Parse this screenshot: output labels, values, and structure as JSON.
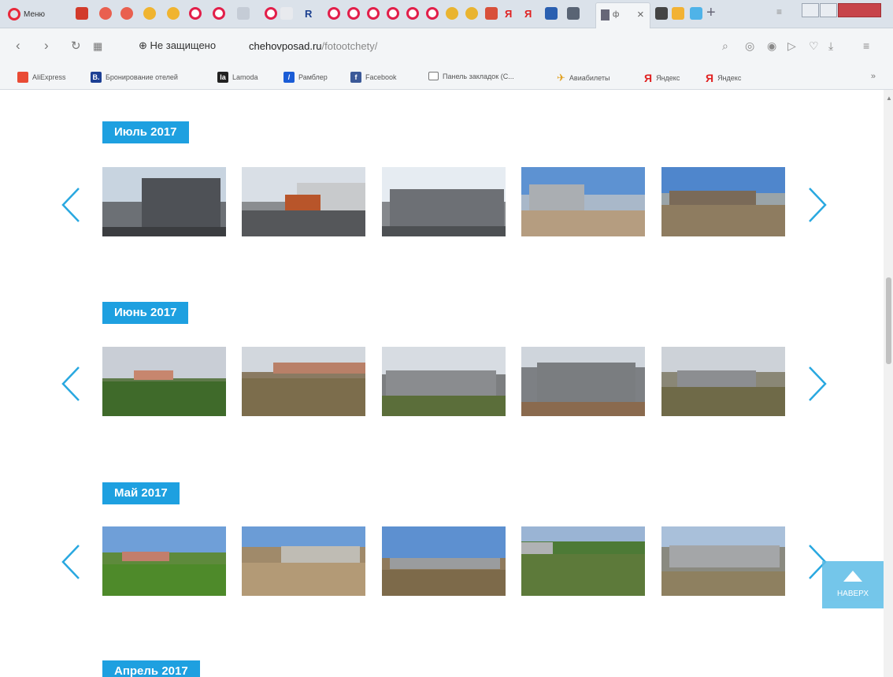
{
  "browser": {
    "menu_label": "Меню",
    "active_tab_label": "ф",
    "security_text": "Не защищено",
    "url_host": "chehovposad.ru",
    "url_path": "/fotootchety/",
    "bookmarks": [
      {
        "label": "AliExpress",
        "color": "#e94b35",
        "glyph": ""
      },
      {
        "label": "Бронирование отелей",
        "color": "#1c3f94",
        "glyph": "B."
      },
      {
        "label": "Lamoda",
        "color": "#222222",
        "glyph": "la"
      },
      {
        "label": "Рамблер",
        "color": "#1a5cd6",
        "glyph": "/"
      },
      {
        "label": "Facebook",
        "color": "#3b5998",
        "glyph": "f"
      },
      {
        "label": "Панель закладок (С...",
        "color": "#ffffff",
        "glyph": ""
      },
      {
        "label": "Авиабилеты",
        "color": "#ffffff",
        "glyph": ""
      },
      {
        "label": "Яндекс",
        "color": "#ffffff",
        "glyph": "Я"
      },
      {
        "label": "Яндекс",
        "color": "#ffffff",
        "glyph": "Я"
      }
    ],
    "bookmarks_more": "»"
  },
  "sections": [
    {
      "month": "Июль 2017"
    },
    {
      "month": "Июнь 2017"
    },
    {
      "month": "Май 2017"
    },
    {
      "month": "Апрель 2017"
    }
  ],
  "back_to_top": "НАВЕРХ",
  "colors": {
    "accent": "#1ea0e0",
    "arrow": "#29a8e0"
  }
}
